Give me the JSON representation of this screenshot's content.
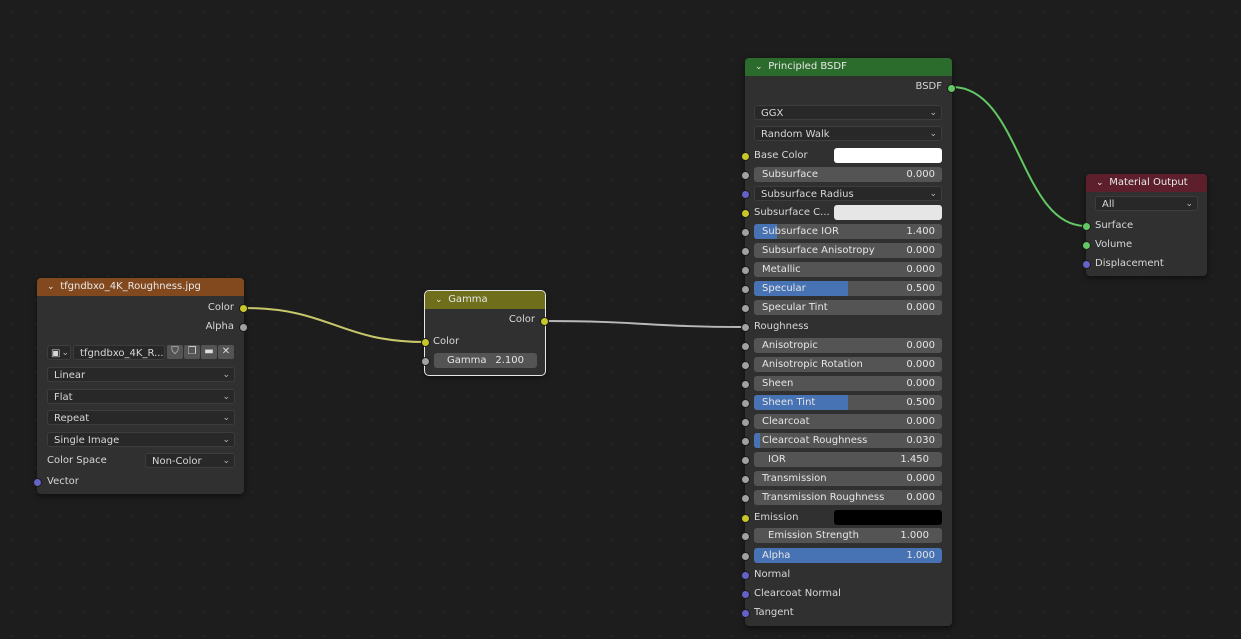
{
  "image_node": {
    "title": "tfgndbxo_4K_Roughness.jpg",
    "outputs": [
      "Color",
      "Alpha"
    ],
    "image_name": "tfgndbxo_4K_R...",
    "interpolation": "Linear",
    "projection": "Flat",
    "extension": "Repeat",
    "source": "Single Image",
    "color_space_label": "Color Space",
    "color_space": "Non-Color",
    "input_vector": "Vector",
    "header_color": "#83491e"
  },
  "gamma_node": {
    "title": "Gamma",
    "output": "Color",
    "input_color": "Color",
    "gamma_label": "Gamma",
    "gamma_value": "2.100",
    "header_color": "#6e6e1b"
  },
  "bsdf_node": {
    "title": "Principled BSDF",
    "output": "BSDF",
    "distribution": "GGX",
    "subsurface_method": "Random Walk",
    "base_color_label": "Base Color",
    "subsurface_color_label": "Subsurface C...",
    "subsurface_radius_label": "Subsurface Radius",
    "roughness_label": "Roughness",
    "emission_label": "Emission",
    "normal_label": "Normal",
    "clearcoat_normal_label": "Clearcoat Normal",
    "tangent_label": "Tangent",
    "header_color": "#2b6b2b",
    "sliders": {
      "subsurface": {
        "label": "Subsurface",
        "value": "0.000",
        "fill": 0.0
      },
      "subsurface_ior": {
        "label": "Subsurface IOR",
        "value": "1.400",
        "fill": 0.12
      },
      "subsurface_anisotropy": {
        "label": "Subsurface Anisotropy",
        "value": "0.000",
        "fill": 0.0
      },
      "metallic": {
        "label": "Metallic",
        "value": "0.000",
        "fill": 0.0
      },
      "specular": {
        "label": "Specular",
        "value": "0.500",
        "fill": 0.5
      },
      "specular_tint": {
        "label": "Specular Tint",
        "value": "0.000",
        "fill": 0.0
      },
      "anisotropic": {
        "label": "Anisotropic",
        "value": "0.000",
        "fill": 0.0
      },
      "anisotropic_rotation": {
        "label": "Anisotropic Rotation",
        "value": "0.000",
        "fill": 0.0
      },
      "sheen": {
        "label": "Sheen",
        "value": "0.000",
        "fill": 0.0
      },
      "sheen_tint": {
        "label": "Sheen Tint",
        "value": "0.500",
        "fill": 0.5
      },
      "clearcoat": {
        "label": "Clearcoat",
        "value": "0.000",
        "fill": 0.0
      },
      "clearcoat_roughness": {
        "label": "Clearcoat Roughness",
        "value": "0.030",
        "fill": 0.03
      },
      "ior": {
        "label": "IOR",
        "value": "1.450",
        "fill": 0.0
      },
      "transmission": {
        "label": "Transmission",
        "value": "0.000",
        "fill": 0.0
      },
      "transmission_roughness": {
        "label": "Transmission Roughness",
        "value": "0.000",
        "fill": 0.0
      },
      "emission_strength": {
        "label": "Emission Strength",
        "value": "1.000",
        "fill": 0.0
      },
      "alpha": {
        "label": "Alpha",
        "value": "1.000",
        "fill": 1.0
      }
    }
  },
  "output_node": {
    "title": "Material Output",
    "target": "All",
    "inputs": [
      "Surface",
      "Volume",
      "Displacement"
    ],
    "header_color": "#5c1f2b"
  },
  "colors": {
    "slider_fill": "#4772b3",
    "wire_yellow": "#c7c76b",
    "wire_grey": "#a8a8a8",
    "wire_green": "#63c763"
  }
}
